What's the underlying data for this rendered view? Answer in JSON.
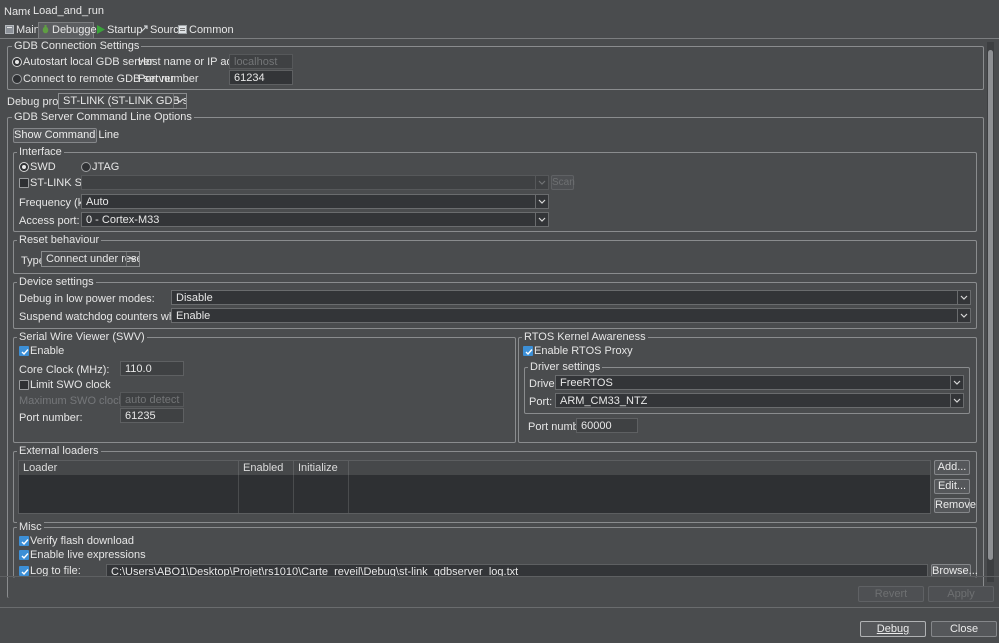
{
  "config": {
    "name_label": "Name:",
    "name_value": "Load_and_run"
  },
  "tabs": [
    {
      "label": "Main",
      "icon": "main-tab-icon"
    },
    {
      "label": "Debugger",
      "icon": "debugger-tab-icon"
    },
    {
      "label": "Startup",
      "icon": "startup-tab-icon"
    },
    {
      "label": "Source",
      "icon": "source-tab-icon"
    },
    {
      "label": "Common",
      "icon": "common-tab-icon"
    }
  ],
  "gdb": {
    "title": "GDB Connection Settings",
    "autostart_label": "Autostart local GDB server",
    "remote_label": "Connect to remote GDB server",
    "host_label": "Host name or IP address",
    "host_value": "localhost",
    "port_label": "Port number",
    "port_value": "61234"
  },
  "probe": {
    "label": "Debug probe",
    "value": "ST-LINK (ST-LINK GDB server)"
  },
  "server": {
    "title": "GDB Server Command Line Options",
    "show_cmd_label": "Show Command Line"
  },
  "interface": {
    "title": "Interface",
    "swd_label": "SWD",
    "jtag_label": "JTAG",
    "stlink_sn_label": "ST-LINK S/N",
    "stlink_sn_value": "",
    "scan_label": "Scan",
    "freq_label": "Frequency (kHz):",
    "freq_value": "Auto",
    "access_label": "Access port:",
    "access_value": "0 - Cortex-M33"
  },
  "reset": {
    "title": "Reset behaviour",
    "type_label": "Type:",
    "type_value": "Connect under reset"
  },
  "device": {
    "title": "Device settings",
    "low_power_label": "Debug in low power modes:",
    "low_power_value": "Disable",
    "watchdog_label": "Suspend watchdog counters while halted:",
    "watchdog_value": "Enable"
  },
  "swv": {
    "title": "Serial Wire Viewer (SWV)",
    "enable_label": "Enable",
    "core_clock_label": "Core Clock (MHz):",
    "core_clock_value": "110.0",
    "limit_swo_label": "Limit SWO clock",
    "max_swo_label": "Maximum SWO clock (kHz):",
    "max_swo_value": "auto detect",
    "port_label": "Port number:",
    "port_value": "61235"
  },
  "rtos": {
    "title": "RTOS Kernel Awareness",
    "enable_label": "Enable RTOS Proxy",
    "driver_group_title": "Driver settings",
    "driver_label": "Driver:",
    "driver_value": "FreeRTOS",
    "port_label": "Port:",
    "port_value": "ARM_CM33_NTZ",
    "port_number_label": "Port number:",
    "port_number_value": "60000"
  },
  "loaders": {
    "title": "External loaders",
    "columns": [
      "Loader",
      "Enabled",
      "Initialize"
    ],
    "rows": [],
    "add_label": "Add...",
    "edit_label": "Edit...",
    "remove_label": "Remove"
  },
  "misc": {
    "title": "Misc",
    "verify_label": "Verify flash download",
    "live_expr_label": "Enable live expressions",
    "log_label": "Log to file:",
    "log_path": "C:\\Users\\ABO1\\Desktop\\Projet\\rs1010\\Carte_reveil\\Debug\\st-link_gdbserver_log.txt",
    "browse_label": "Browse..."
  },
  "footer": {
    "revert_label": "Revert",
    "apply_label": "Apply",
    "debug_label": "Debug",
    "close_label": "Close"
  },
  "colors": {
    "background": "#4a4c4e",
    "field_background": "#333538",
    "accent_checked": "#3c8fd6",
    "startup_icon": "#3aa33a"
  }
}
